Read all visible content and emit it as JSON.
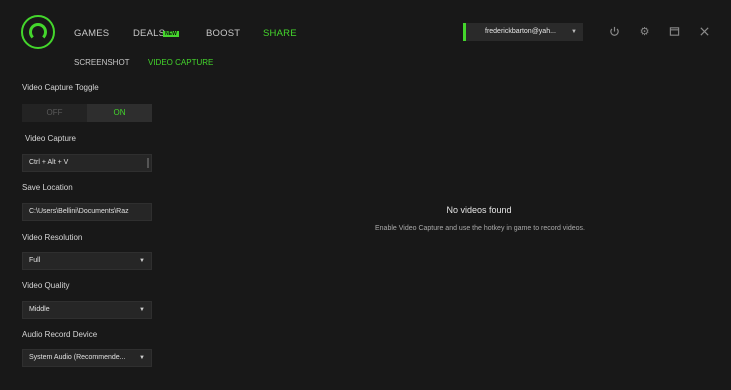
{
  "nav": {
    "games": "GAMES",
    "deals": "DEALS",
    "deals_badge": "NEW",
    "boost": "BOOST",
    "share": "SHARE"
  },
  "subnav": {
    "screenshot": "SCREENSHOT",
    "video_capture": "VIDEO CAPTURE"
  },
  "account": {
    "email": "frederickbarton@yah..."
  },
  "settings": {
    "toggle_label": "Video Capture Toggle",
    "toggle_off": "OFF",
    "toggle_on": "ON",
    "video_capture_label": "Video Capture",
    "hotkey_value": "Ctrl + Alt + V",
    "save_location_label": "Save Location",
    "save_location_value": "C:\\Users\\Bellini\\Documents\\Raz",
    "resolution_label": "Video Resolution",
    "resolution_value": "Full",
    "quality_label": "Video Quality",
    "quality_value": "Middle",
    "audio_label": "Audio Record Device",
    "audio_value": "System Audio (Recommende..."
  },
  "empty": {
    "title": "No videos found",
    "subtitle": "Enable Video Capture and use the hotkey in game to record videos."
  },
  "colors": {
    "accent": "#44d62c",
    "background": "#181818"
  },
  "icons": [
    "razer-logo-icon",
    "power-icon",
    "gear-icon",
    "window-icon",
    "close-icon",
    "chevron-down-icon"
  ]
}
